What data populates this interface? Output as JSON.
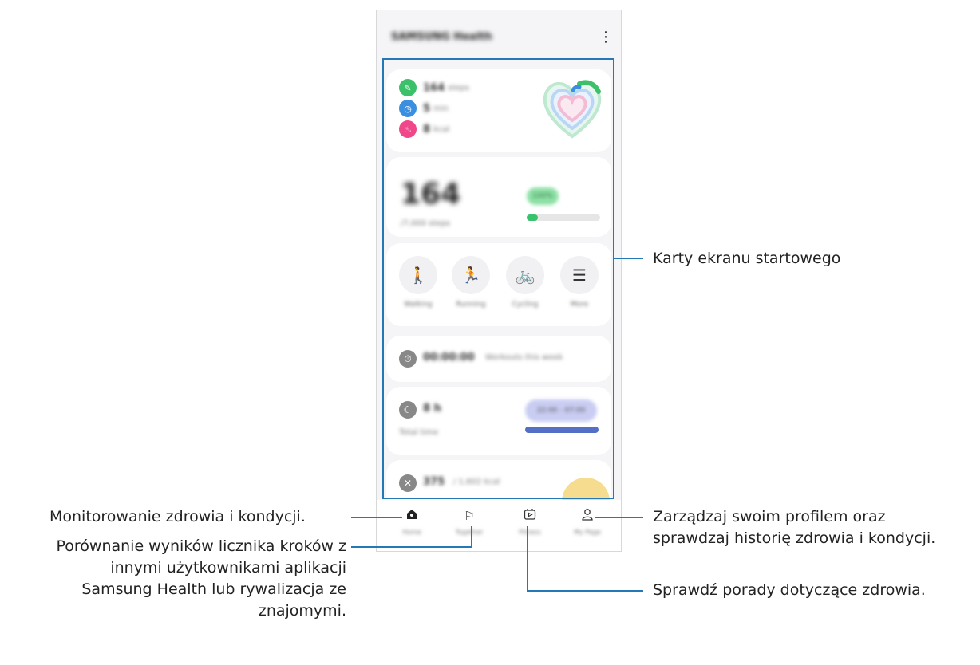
{
  "app": {
    "title": "SAMSUNG Health",
    "more_icon": "⋮"
  },
  "today_card": {
    "metrics": [
      {
        "value": "164",
        "unit": "steps",
        "color": "#3cc06a"
      },
      {
        "value": "5",
        "unit": "min",
        "color": "#3a8fe0"
      },
      {
        "value": "8",
        "unit": "kcal",
        "color": "#f0478a"
      }
    ]
  },
  "steps_card": {
    "count": "164",
    "goal": "/7,000 steps",
    "badge": "100%",
    "progress": 0.15
  },
  "activities": [
    {
      "icon": "walking-icon",
      "glyph": "🚶",
      "label": "Walking"
    },
    {
      "icon": "running-icon",
      "glyph": "🏃",
      "label": "Running"
    },
    {
      "icon": "cycling-icon",
      "glyph": "🚲",
      "label": "Cycling"
    },
    {
      "icon": "list-icon",
      "glyph": "☰",
      "label": "More"
    }
  ],
  "timer_card": {
    "value": "00:00:00",
    "note": "Workouts this week"
  },
  "sleep_card": {
    "value": "8 h",
    "label": "Total time",
    "range": "22:00 - 07:00"
  },
  "food_card": {
    "value": "375",
    "unit": "/ 1,602 kcal"
  },
  "nav": [
    {
      "icon": "home-icon",
      "glyph": "⌂",
      "label": "Home"
    },
    {
      "icon": "flag-icon",
      "glyph": "⚐",
      "label": "Together"
    },
    {
      "icon": "fitness-icon",
      "glyph": "▷",
      "label": "Fitness"
    },
    {
      "icon": "profile-icon",
      "glyph": "👤",
      "label": "My Page"
    }
  ],
  "callouts": {
    "cards": "Karty ekranu startowego",
    "home_line1": "Monitorowanie zdrowia i kondycji.",
    "profile_line1": "Zarządzaj swoim profilem oraz",
    "profile_line2": "sprawdzaj historię zdrowia i kondycji.",
    "together_line1": "Porównanie wyników licznika kroków z",
    "together_line2": "innymi użytkownikami aplikacji",
    "together_line3": "Samsung Health lub rywalizacja ze",
    "together_line4": "znajomymi.",
    "fitness_line1": "Sprawdź porady dotyczące zdrowia."
  },
  "colors": {
    "callout_line": "#2478b5"
  }
}
